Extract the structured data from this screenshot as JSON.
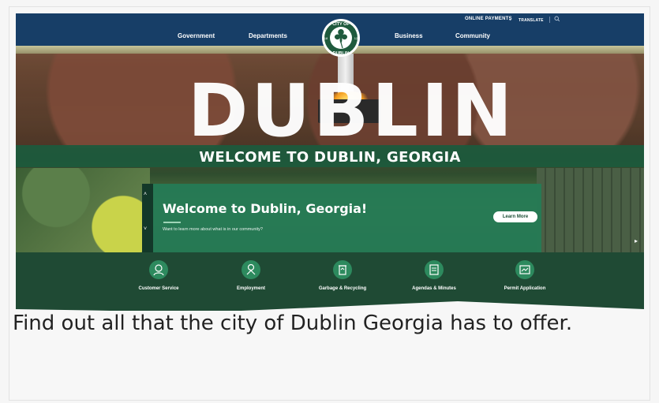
{
  "nav": {
    "utility": {
      "online_payments": "ONLINE PAYMENTS",
      "caret": "⌄",
      "translate": "TRANSLATE"
    },
    "items": [
      "Government",
      "Departments",
      "Business",
      "Community"
    ]
  },
  "seal": {
    "top_text": "CITY OF",
    "bottom_text": "DUBLIN",
    "year_left": "18",
    "year_right": "12"
  },
  "hero": {
    "big_word": "DUBLIN",
    "banner": "WELCOME TO DUBLIN, GEORGIA",
    "arrow_up": "˄",
    "arrow_down": "˅",
    "arrow_right": "▸",
    "welcome_title": "Welcome to Dublin, Georgia!",
    "welcome_sub": "Want to learn more about what is in our community?",
    "learn_more": "Learn More"
  },
  "quick_links": [
    {
      "label": "Customer Service",
      "icon": "customer-service-icon"
    },
    {
      "label": "Employment",
      "icon": "employment-icon"
    },
    {
      "label": "Garbage & Recycling",
      "icon": "recycling-icon"
    },
    {
      "label": "Agendas & Minutes",
      "icon": "agenda-icon"
    },
    {
      "label": "Permit Application",
      "icon": "permit-icon"
    }
  ],
  "caption": "Find out all that the city of Dublin Georgia has to offer.",
  "colors": {
    "nav_bg": "#173e67",
    "brand_green": "#1f4a34",
    "accent_green": "#2d8a5e"
  }
}
